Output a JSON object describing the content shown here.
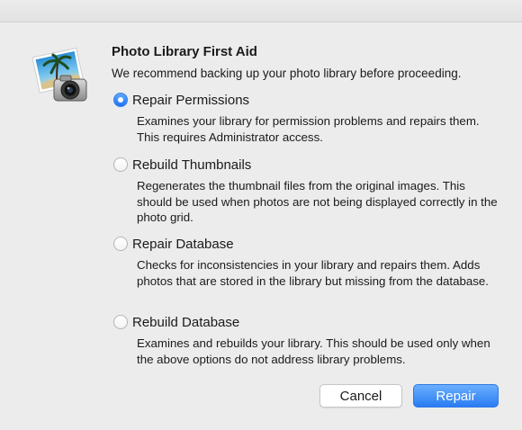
{
  "dialog": {
    "title": "Photo Library First Aid",
    "subtitle": "We recommend backing up your photo library before proceeding.",
    "icon": "photos-camera-icon"
  },
  "options": [
    {
      "label": "Repair Permissions",
      "description": "Examines your library for permission problems and repairs them. This requires Administrator access.",
      "selected": true
    },
    {
      "label": "Rebuild Thumbnails",
      "description": "Regenerates the thumbnail files from the original images. This should be used when photos are not being displayed correctly in the photo grid.",
      "selected": false
    },
    {
      "label": "Repair Database",
      "description": "Checks for inconsistencies in your library and repairs them. Adds photos that are stored in the library but missing from the database.",
      "selected": false
    },
    {
      "label": "Rebuild Database",
      "description": "Examines and rebuilds your library. This should be used only when the above options do not address library problems.",
      "selected": false
    }
  ],
  "buttons": {
    "cancel_label": "Cancel",
    "repair_label": "Repair"
  },
  "colors": {
    "accent": "#2a7cf3",
    "background": "#ececec"
  }
}
